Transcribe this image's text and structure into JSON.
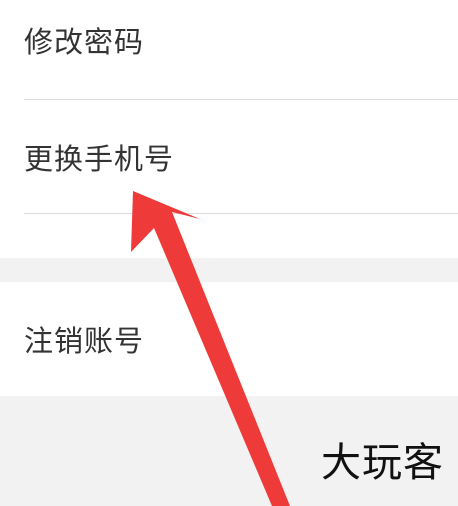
{
  "settings": {
    "items": [
      {
        "label": "修改密码"
      },
      {
        "label": "更换手机号"
      },
      {
        "label": "注销账号"
      }
    ]
  },
  "watermark": {
    "text": "大玩客"
  },
  "colors": {
    "background": "#f2f2f2",
    "row_background": "#ffffff",
    "text": "#333333",
    "divider": "#dcdcdc",
    "arrow": "#ef3a3a"
  }
}
